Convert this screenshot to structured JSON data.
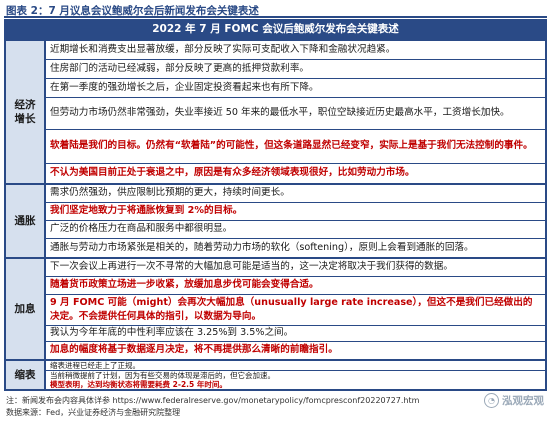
{
  "figure": {
    "title": "图表 2：7 月议息会议鲍威尔会后新闻发布会关键表述"
  },
  "table": {
    "header": "2022 年 7 月 FOMC 会议后鲍威尔发布会关键表述",
    "sections": [
      {
        "category": [
          "经济",
          "增长"
        ],
        "rows": [
          "近期增长和消费支出显著放缓，部分反映了实际可支配收入下降和金融状况趋紧。",
          "住房部门的活动已经减弱，部分反映了更高的抵押贷款利率。",
          "在第一季度的强劲增长之后，企业固定投资看起来也有所下降。",
          "但劳动力市场仍然非常强劲，失业率接近 50 年来的最低水平，职位空缺接近历史最高水平，工资增长加快。",
          "软着陆是我们的目标。仍然有“软着陆”的可能性，但这条道路显然已经变窄，实际上是基于我们无法控制的事件。",
          "不认为美国目前正处于衰退之中，原因是有众多经济领域表现很好，比如劳动力市场。"
        ]
      },
      {
        "category": [
          "通胀"
        ],
        "rows": [
          "需求仍然强劲，供应限制比预期的更大，持续时间更长。",
          "我们坚定地致力于将通胀恢复到 2%的目标。",
          "广泛的价格压力在商品和服务中都很明显。",
          "通胀与劳动力市场紧张是相关的，随着劳动力市场的软化（softening），原则上会看到通胀的回落。"
        ]
      },
      {
        "category": [
          "加息"
        ],
        "rows": [
          "下一次会议上再进行一次不寻常的大幅加息可能是适当的，这一决定将取决于我们获得的数据。",
          "随着货币政策立场进一步收紧，放缓加息步伐可能会变得合适。",
          "9 月 FOMC 可能（might）会再次大幅加息（unusually large rate increase），但这不是我们已经做出的决定。不会提供任何具体的指引，以数据为导向。",
          "我认为今年年底的中性利率应该在 3.25%到 3.5%之间。",
          "加息的幅度将基于数据逐月决定，将不再提供那么清晰的前瞻指引。"
        ]
      },
      {
        "category": [
          "缩表"
        ],
        "rows": [
          "缩表进程已经走上了正规。",
          "当前稍微提前了计划，因为有些交易的体现是滞后的，但它会加速。",
          "模型表明，达到均衡状态将需要耗费 2-2.5 年时间。"
        ]
      }
    ]
  },
  "notes": {
    "source_note": "注：新闻发布会内容具体详参 https://www.federalreserve.gov/monetarypolicy/fomcpresconf20220727.htm",
    "data_source": "数据来源：Fed，兴业证券经济与金融研究院整理"
  },
  "watermark": {
    "text": "泓观宏观"
  }
}
